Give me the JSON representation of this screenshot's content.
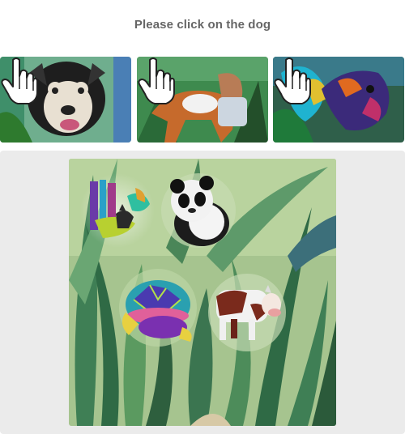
{
  "prompt": {
    "text": "Please click on the dog"
  },
  "examples": [
    {
      "name": "dog example 1",
      "icon": "pointer-hand-icon"
    },
    {
      "name": "dog example 2",
      "icon": "pointer-hand-icon"
    },
    {
      "name": "dog example 3",
      "icon": "pointer-hand-icon"
    }
  ],
  "scene": {
    "background": "watercolor jungle leaves",
    "animals": [
      "abstract-colorful-cat",
      "panda",
      "turtle",
      "cow"
    ]
  },
  "colors": {
    "title": "#666666",
    "panel_bg": "#ebebeb",
    "leaf_dark": "#2f6a45",
    "leaf_light": "#9cc48a"
  }
}
